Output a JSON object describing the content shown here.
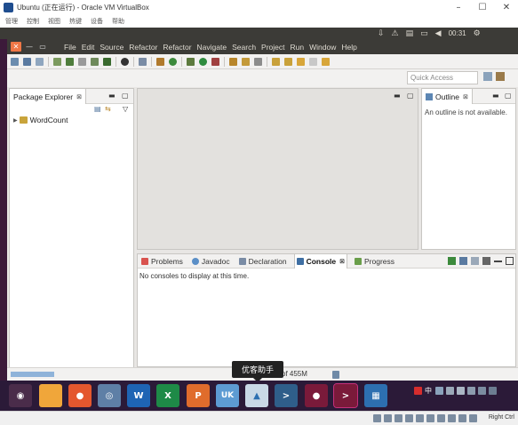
{
  "vbox": {
    "title": "Ubuntu (正在运行) - Oracle VM VirtualBox",
    "menu": [
      "管理",
      "控制",
      "视图",
      "热键",
      "设备",
      "帮助"
    ],
    "minimize": "–",
    "maximize": "☐",
    "close": "✕"
  },
  "ubuntu_panel": {
    "clock": "00:31",
    "icons": [
      "dropbox-icon",
      "network-icon",
      "clipboard-icon",
      "battery-icon",
      "volume-icon",
      "power-icon"
    ]
  },
  "eclipse": {
    "menu": [
      "File",
      "Edit",
      "Source",
      "Refactor",
      "Refactor",
      "Navigate",
      "Search",
      "Project",
      "Run",
      "Window",
      "Help"
    ],
    "quick_access": "Quick Access",
    "package_explorer": {
      "tab": "Package Explorer",
      "tab_close": "⊠",
      "projects": [
        "WordCount"
      ]
    },
    "outline": {
      "tab": "Outline",
      "tab_close": "⊠",
      "message": "An outline is not available."
    },
    "bottom_tabs": [
      {
        "label": "Problems",
        "color": "#d9534f",
        "active": false
      },
      {
        "label": "Javadoc",
        "color": "#5b8fc7",
        "active": false
      },
      {
        "label": "Declaration",
        "color": "#7a8ca5",
        "active": false
      },
      {
        "label": "Console",
        "color": "#3f6fa3",
        "active": true,
        "close": "⊠"
      },
      {
        "label": "Progress",
        "color": "#6a9e4a",
        "active": false
      }
    ],
    "console_message": "No consoles to display at this time.",
    "heap": "l of 455M"
  },
  "tooltip": "优客助手",
  "taskbar": {
    "apps": [
      {
        "name": "ubuntu-icon",
        "color": "#4a2c4a",
        "glyph": "◉"
      },
      {
        "name": "files-icon",
        "color": "#f0a63a",
        "glyph": ""
      },
      {
        "name": "firefox-icon",
        "color": "#e4572e",
        "glyph": "●"
      },
      {
        "name": "chromium-icon",
        "color": "#5e7fa6",
        "glyph": "◎"
      },
      {
        "name": "word-icon",
        "color": "#1e64b4",
        "glyph": "W"
      },
      {
        "name": "excel-icon",
        "color": "#1e8a47",
        "glyph": "X"
      },
      {
        "name": "powerpoint-icon",
        "color": "#e06c2c",
        "glyph": "P"
      },
      {
        "name": "uk-icon",
        "color": "#5d9bd3",
        "glyph": "UK"
      },
      {
        "name": "youke-icon",
        "color": "#c9d8e6",
        "glyph": "▲"
      },
      {
        "name": "terminal-icon",
        "color": "#2f5e8a",
        "glyph": ">"
      },
      {
        "name": "recorder-icon",
        "color": "#7a1a3a",
        "glyph": "●"
      },
      {
        "name": "terminal-2-icon",
        "color": "#7a1a3a",
        "glyph": ">",
        "active": true
      },
      {
        "name": "eclipse-icon",
        "color": "#2d6fb0",
        "glyph": "▦"
      }
    ],
    "ime": "中"
  },
  "statusbar": {
    "right_ctrl": "Right Ctrl"
  }
}
